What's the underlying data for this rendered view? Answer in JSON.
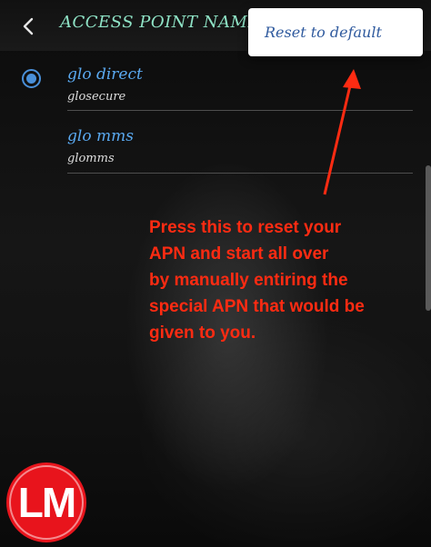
{
  "header": {
    "title": "ACCESS POINT NAMES",
    "back_icon": "chevron-left-icon"
  },
  "menu": {
    "items": [
      {
        "label": "Reset to default"
      }
    ]
  },
  "apn_list": [
    {
      "name": "glo direct",
      "apn": "glosecure",
      "selected": true
    },
    {
      "name": "glo mms",
      "apn": "glomms",
      "selected": false
    }
  ],
  "annotation": {
    "lines": [
      "Press this to reset your",
      "APN and start all over",
      "by manually entiring the",
      "special APN that would be",
      "given to you."
    ],
    "color": "#ff2b12"
  },
  "logo": {
    "text": "LM",
    "color": "#e8141c"
  },
  "colors": {
    "accent": "#4a90d9",
    "title": "#8fe3c6",
    "popup_text": "#2f5a9e"
  }
}
